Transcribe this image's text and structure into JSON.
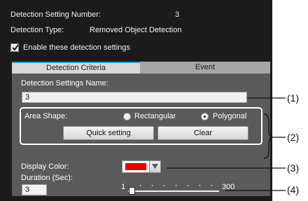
{
  "header": {
    "setting_number_label": "Detection Setting Number:",
    "setting_number_value": "3",
    "type_label": "Detection Type:",
    "type_value": "Removed Object Detection",
    "enable_label": "Enable these detection settings",
    "enable_checked": true
  },
  "tabs": [
    {
      "label": "Detection Criteria",
      "active": true
    },
    {
      "label": "Event",
      "active": false
    }
  ],
  "form": {
    "name_label": "Detection Settings Name:",
    "name_value": "3",
    "area_shape_label": "Area Shape:",
    "rectangular_label": "Rectangular",
    "polygonal_label": "Polygonal",
    "selected_shape": "Polygonal",
    "quick_setting_label": "Quick setting",
    "clear_label": "Clear",
    "display_color_label": "Display Color:",
    "display_color": "#e00000",
    "duration_label": "Duration (Sec):",
    "duration_value": "3",
    "slider_min": "1",
    "slider_max": "300",
    "slider_value": 3
  },
  "callouts": [
    "(1)",
    "(2)",
    "(3)",
    "(4)"
  ],
  "colors": {
    "panel_bg": "#1b1b1b",
    "content_bg": "#5a5a5a",
    "active_tab_accent": "#2e92d8"
  }
}
